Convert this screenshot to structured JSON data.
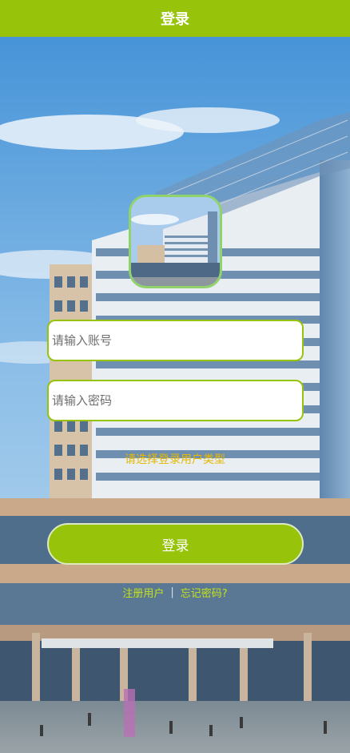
{
  "header": {
    "title": "登录"
  },
  "form": {
    "account_placeholder": "请输入账号",
    "password_placeholder": "请输入密码",
    "user_type_prompt": "请选择登录用户类型",
    "login_label": "登录"
  },
  "links": {
    "register": "注册用户",
    "separator": "|",
    "forgot_password": "忘记密码?"
  },
  "colors": {
    "brand_green": "#97c30b",
    "prompt_yellow": "#e6b800"
  }
}
